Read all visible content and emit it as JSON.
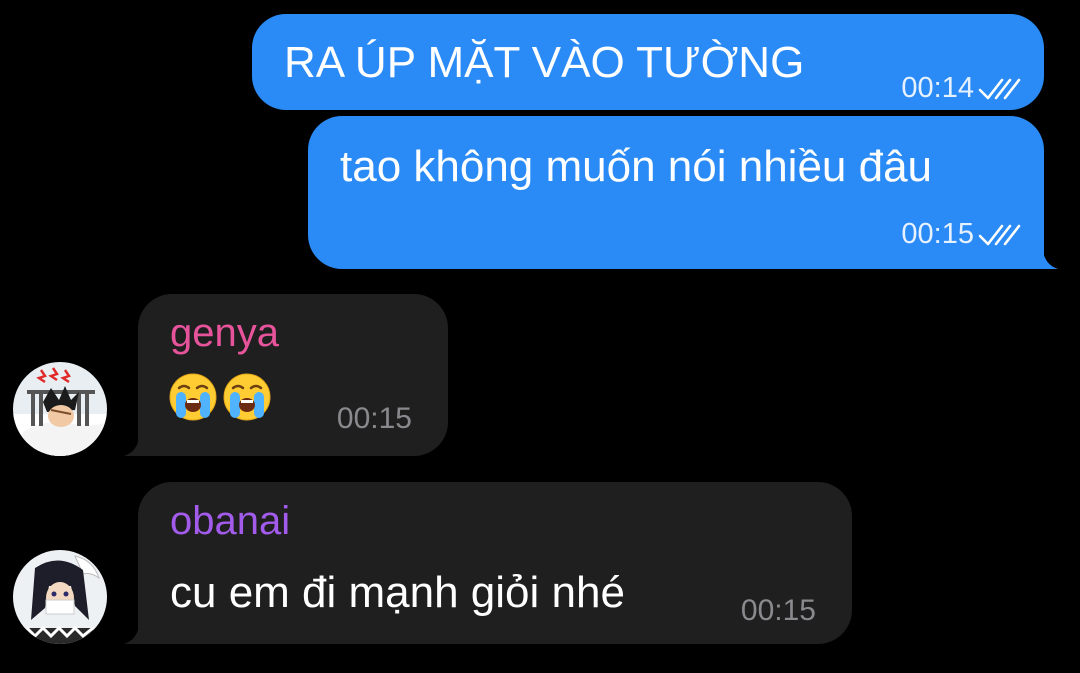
{
  "messages": [
    {
      "direction": "outgoing",
      "text": "RA ÚP MẶT VÀO TƯỜNG",
      "time": "00:14",
      "status_icon": "double-check-icon"
    },
    {
      "direction": "outgoing",
      "text": "tao không muốn nói nhiều đâu",
      "time": "00:15",
      "status_icon": "double-check-icon"
    },
    {
      "direction": "incoming",
      "sender": "genya",
      "sender_color": "#e7549b",
      "content": [
        "crying-face-emoji",
        "crying-face-emoji"
      ],
      "time": "00:15",
      "avatar": "genya-avatar"
    },
    {
      "direction": "incoming",
      "sender": "obanai",
      "sender_color": "#a25bea",
      "text": "cu em đi mạnh giỏi nhé",
      "time": "00:15",
      "avatar": "obanai-avatar"
    }
  ],
  "colors": {
    "background": "#000000",
    "outgoing_bubble": "#2a8bf7",
    "incoming_bubble": "#1f1f1f",
    "timestamp_incoming": "#8a8a8e"
  }
}
